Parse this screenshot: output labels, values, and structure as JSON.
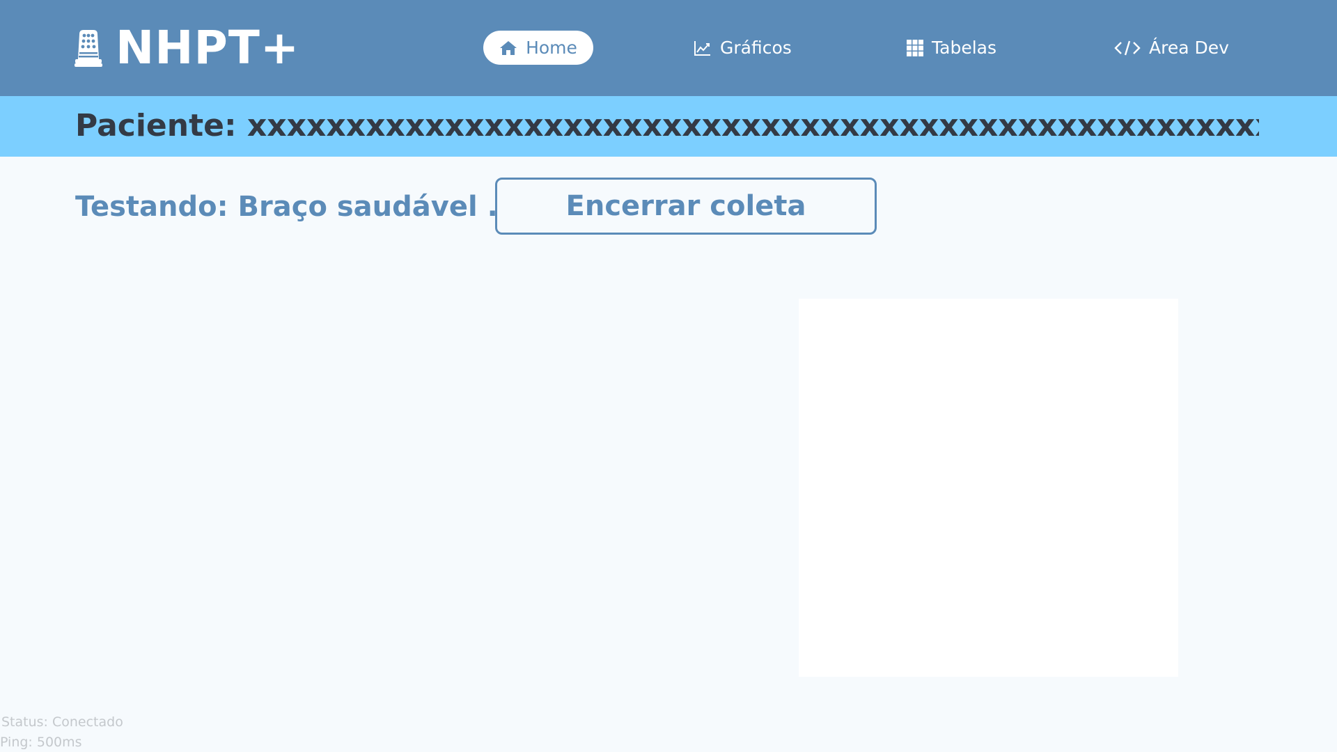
{
  "app": {
    "logo_text": "NHPT+",
    "logo_icon": "thimble-icon"
  },
  "nav": {
    "items": [
      {
        "label": "Home",
        "icon": "home-icon",
        "active": true
      },
      {
        "label": "Gráficos",
        "icon": "line-chart-icon",
        "active": false
      },
      {
        "label": "Tabelas",
        "icon": "grid-icon",
        "active": false
      },
      {
        "label": "Área Dev",
        "icon": "code-icon",
        "active": false
      }
    ]
  },
  "patient": {
    "label": "Paciente: xxxxxxxxxxxxxxxxxxxxxxxxxxxxxxxxxxxxxxxxxxxxxxxxxxxxxxx"
  },
  "test": {
    "status_label": "Testando: Braço saudável ...",
    "end_button_label": "Encerrar coleta"
  },
  "connection": {
    "status": "Status: Conectado",
    "ping": "Ping: 500ms"
  },
  "colors": {
    "header": "#5b8bb8",
    "patient_bar": "#7ccfff",
    "accent": "#5b8bb8",
    "background": "#f6fafd",
    "patient_text": "#333a45"
  }
}
